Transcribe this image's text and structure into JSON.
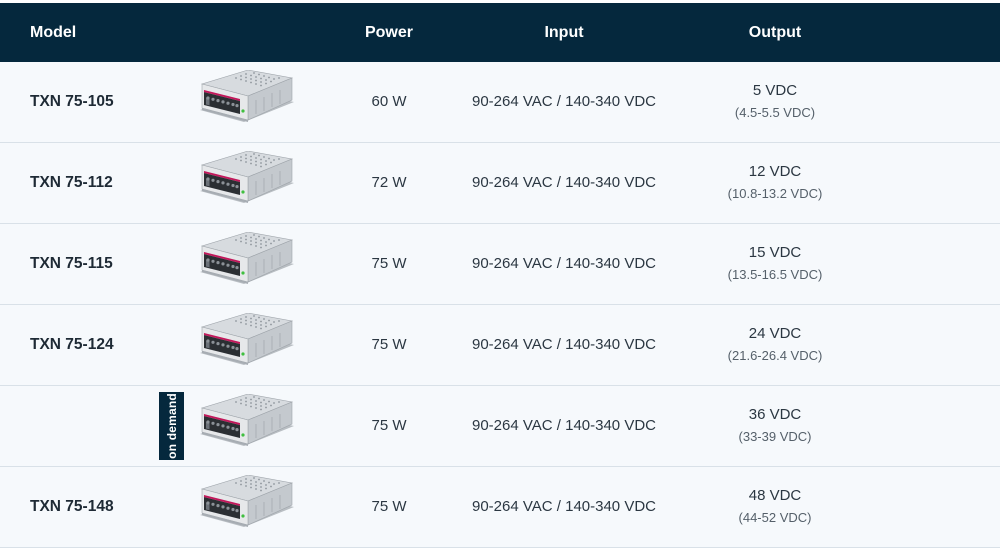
{
  "header": {
    "model": "Model",
    "power": "Power",
    "input": "Input",
    "output": "Output"
  },
  "rows": [
    {
      "model": "TXN 75-105",
      "product_icon": "power-supply-image",
      "power": "60 W",
      "input": "90-264 VAC / 140-340 VDC",
      "output": "5 VDC",
      "output_range": "(4.5-5.5 VDC)",
      "badge": ""
    },
    {
      "model": "TXN 75-112",
      "product_icon": "power-supply-image",
      "power": "72 W",
      "input": "90-264 VAC / 140-340 VDC",
      "output": "12 VDC",
      "output_range": "(10.8-13.2 VDC)",
      "badge": ""
    },
    {
      "model": "TXN 75-115",
      "product_icon": "power-supply-image",
      "power": "75 W",
      "input": "90-264 VAC / 140-340 VDC",
      "output": "15 VDC",
      "output_range": "(13.5-16.5 VDC)",
      "badge": ""
    },
    {
      "model": "TXN 75-124",
      "product_icon": "power-supply-image",
      "power": "75 W",
      "input": "90-264 VAC / 140-340 VDC",
      "output": "24 VDC",
      "output_range": "(21.6-26.4 VDC)",
      "badge": ""
    },
    {
      "model": "",
      "product_icon": "power-supply-image",
      "power": "75 W",
      "input": "90-264 VAC / 140-340 VDC",
      "output": "36 VDC",
      "output_range": "(33-39 VDC)",
      "badge": "on demand"
    },
    {
      "model": "TXN 75-148",
      "product_icon": "power-supply-image",
      "power": "75 W",
      "input": "90-264 VAC / 140-340 VDC",
      "output": "48 VDC",
      "output_range": "(44-52 VDC)",
      "badge": ""
    }
  ],
  "colors": {
    "header_bg": "#05283d",
    "row_bg": "#f6f9fc",
    "row_border": "#d9e1e8",
    "terminal_pink": "#c2185b"
  }
}
